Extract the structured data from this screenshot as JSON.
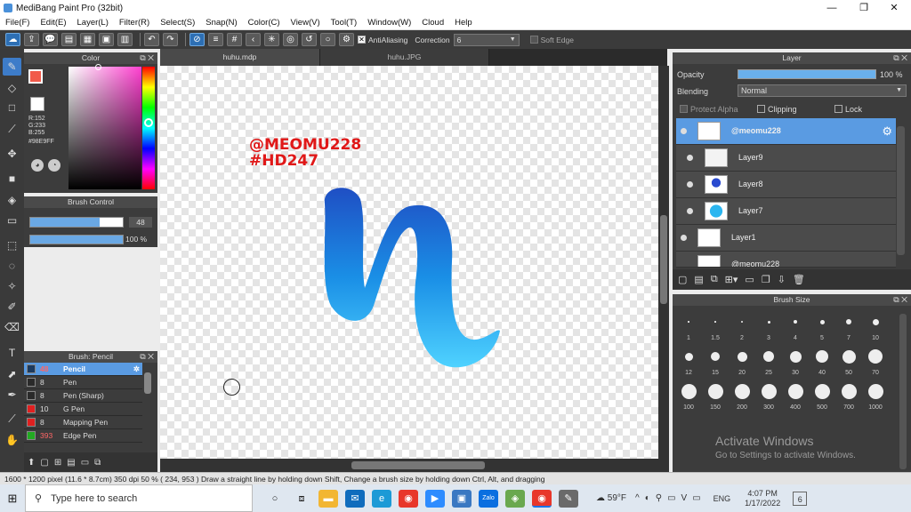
{
  "window": {
    "title": "MediBang Paint Pro (32bit)"
  },
  "menu": [
    "File(F)",
    "Edit(E)",
    "Layer(L)",
    "Filter(R)",
    "Select(S)",
    "Snap(N)",
    "Color(C)",
    "View(V)",
    "Tool(T)",
    "Window(W)",
    "Cloud",
    "Help"
  ],
  "toolbar": {
    "antialiasing": "AntiAliasing",
    "correction_label": "Correction",
    "correction_value": "6",
    "soft_edge": "Soft Edge"
  },
  "color_panel": {
    "title": "Color",
    "r": "R:152",
    "g": "G:233",
    "b": "B:255",
    "hex": "#98E9FF",
    "primary": "#f15a4a",
    "secondary": "#e8d3a0"
  },
  "brush_control": {
    "title": "Brush Control",
    "size": "48",
    "opacity": "100 %",
    "size_fill": 0.75,
    "opacity_fill": 1.0
  },
  "brush_list": {
    "title": "Brush: Pencil",
    "items": [
      {
        "size": "48",
        "name": "Pencil",
        "color": "#1c3a5e"
      },
      {
        "size": "8",
        "name": "Pen",
        "color": "#2a2a2a"
      },
      {
        "size": "8",
        "name": "Pen (Sharp)",
        "color": "#2a2a2a"
      },
      {
        "size": "10",
        "name": "G Pen",
        "color": "#e02020"
      },
      {
        "size": "8",
        "name": "Mapping Pen",
        "color": "#e02020"
      },
      {
        "size": "393",
        "name": "Edge Pen",
        "color": "#22aa22"
      }
    ]
  },
  "tabs": [
    "huhu.mdp",
    "huhu.JPG"
  ],
  "canvas": {
    "text_line1": "@MEOMU228",
    "text_line2": "#HD247"
  },
  "layer_panel": {
    "title": "Layer",
    "opacity_label": "Opacity",
    "opacity_value": "100 %",
    "blending_label": "Blending",
    "blending_value": "Normal",
    "protect_alpha": "Protect Alpha",
    "clipping": "Clipping",
    "lock": "Lock",
    "layers": [
      "@meomu228",
      "Layer9",
      "Layer8",
      "Layer7",
      "Layer1",
      "@meomu228"
    ]
  },
  "brush_size": {
    "title": "Brush Size",
    "sizes": [
      "1",
      "1.5",
      "2",
      "3",
      "4",
      "5",
      "7",
      "10",
      "12",
      "15",
      "20",
      "25",
      "30",
      "40",
      "50",
      "70",
      "100",
      "150",
      "200",
      "300",
      "400",
      "500",
      "700",
      "1000"
    ]
  },
  "watermark": {
    "line1": "Activate Windows",
    "line2": "Go to Settings to activate Windows."
  },
  "status": {
    "text": "1600 * 1200 pixel   (11.6 * 8.7cm)   350 dpi   50 %   ( 234, 953 )   Draw a straight line by holding down Shift, Change a brush size by holding down Ctrl, Alt, and dragging"
  },
  "taskbar": {
    "search": "Type here to search",
    "temp": "59°F",
    "lang": "ENG",
    "time": "4:07 PM",
    "date": "1/17/2022",
    "notif": "6"
  }
}
